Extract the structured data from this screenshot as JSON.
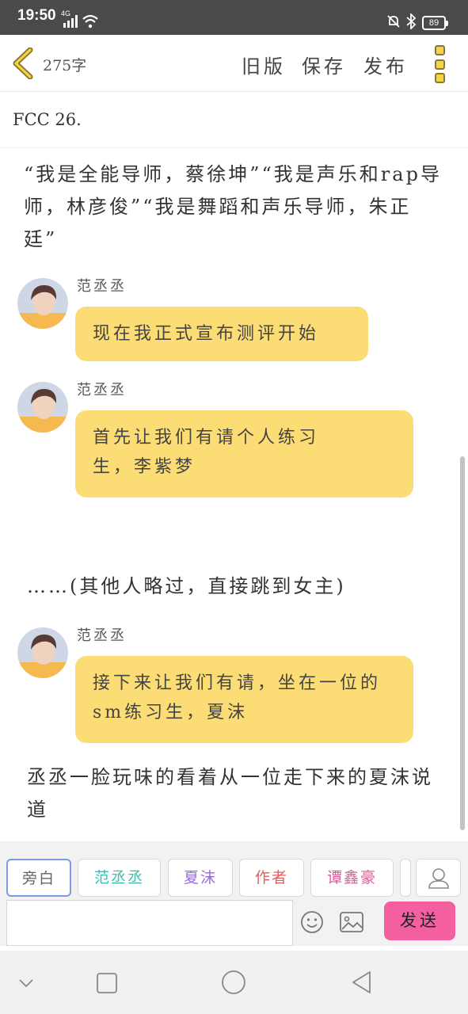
{
  "status_bar": {
    "time": "19:50",
    "network": "4G",
    "battery": "89"
  },
  "header": {
    "back_icon": "chevron-left-icon",
    "word_count": "275字",
    "actions": [
      "旧版",
      "保存",
      "发布"
    ],
    "more_icon": "more-vertical-icon"
  },
  "title": "FCC 26.",
  "content": {
    "intro": "“我是全能导师，蔡徐坤”“我是声乐和rap导师，林彦俊”“我是舞蹈和声乐导师，朱正廷”",
    "messages": [
      {
        "speaker": "范丞丞",
        "text": "现在我正式宣布测评开始"
      },
      {
        "speaker": "范丞丞",
        "text": "首先让我们有请个人练习生，李紫梦"
      },
      {
        "speaker": "范丞丞",
        "text": "接下来让我们有请，坐在一位的sm练习生，夏沫"
      }
    ],
    "skip_note": "……(其他人略过，直接跳到女主)",
    "outro": "丞丞一脸玩味的看着从一位走下来的夏沫说道"
  },
  "roles": [
    {
      "label": "旁白",
      "color": "#666666"
    },
    {
      "label": "范丞丞",
      "color": "#3fbcb0"
    },
    {
      "label": "夏沫",
      "color": "#9a6ad8"
    },
    {
      "label": "作者",
      "color": "#e05d5d"
    },
    {
      "label": "谭鑫豪",
      "color": "#e0579a"
    }
  ],
  "composer": {
    "input_value": "",
    "send_label": "发送"
  },
  "colors": {
    "bubble": "#fcdc74",
    "send": "#f35f9f",
    "accent": "#f5d447"
  }
}
